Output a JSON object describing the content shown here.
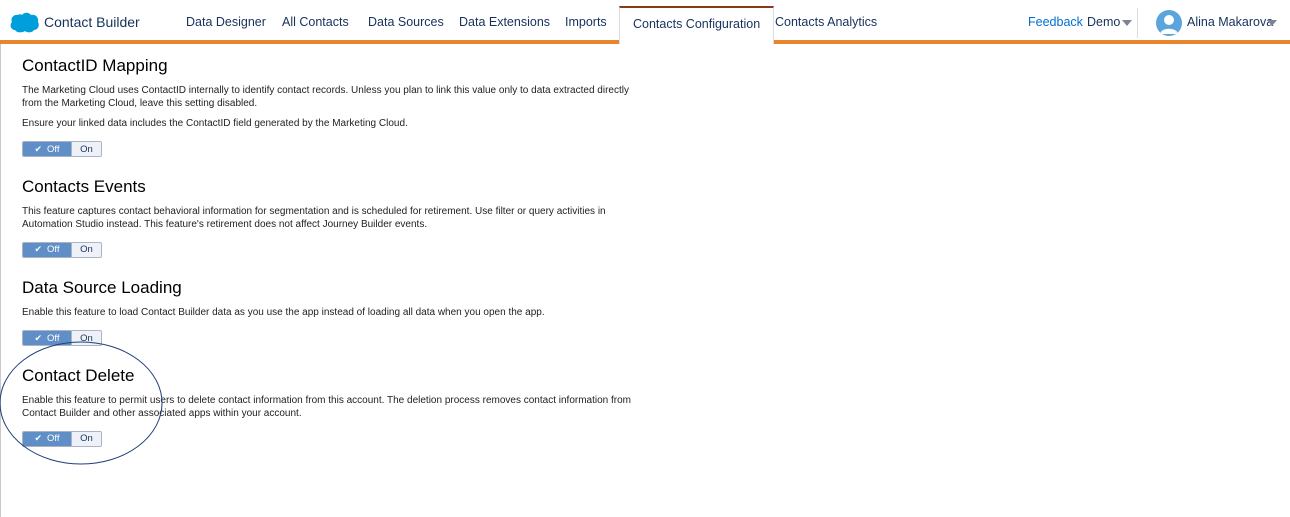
{
  "header": {
    "app_name": "Contact Builder",
    "tabs": [
      {
        "label": "Data Designer"
      },
      {
        "label": "All Contacts"
      },
      {
        "label": "Data Sources"
      },
      {
        "label": "Data Extensions"
      },
      {
        "label": "Imports"
      },
      {
        "label": "Contacts Configuration",
        "active": true
      },
      {
        "label": "Contacts Analytics"
      }
    ],
    "feedback": "Feedback",
    "business_unit": "Demo",
    "user_name": "Alina Makarova",
    "accent_color": "#e8862e"
  },
  "sections": [
    {
      "title": "ContactID Mapping",
      "paragraphs": [
        "The Marketing Cloud uses ContactID internally to identify contact records. Unless you plan to link this value only to data extracted directly from the Marketing Cloud, leave this setting disabled.",
        "Ensure your linked data includes the ContactID field generated by the Marketing Cloud."
      ],
      "toggle": {
        "off": "Off",
        "on": "On",
        "selected": "Off"
      }
    },
    {
      "title": "Contacts Events",
      "paragraphs": [
        "This feature captures contact behavioral information for segmentation and is scheduled for retirement. Use filter or query activities in Automation Studio instead. This feature's retirement does not affect Journey Builder events."
      ],
      "toggle": {
        "off": "Off",
        "on": "On",
        "selected": "Off"
      }
    },
    {
      "title": "Data Source Loading",
      "paragraphs": [
        "Enable this feature to load Contact Builder data as you use the app instead of loading all data when you open the app."
      ],
      "toggle": {
        "off": "Off",
        "on": "On",
        "selected": "Off"
      }
    },
    {
      "title": "Contact Delete",
      "paragraphs": [
        "Enable this feature to permit users to delete contact information from this account. The deletion process removes contact information from Contact Builder and other associated apps within your account."
      ],
      "toggle": {
        "off": "Off",
        "on": "On",
        "selected": "Off"
      }
    }
  ]
}
